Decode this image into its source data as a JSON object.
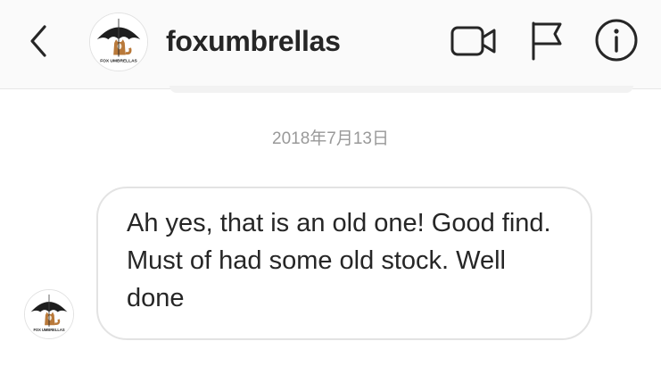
{
  "header": {
    "username": "foxumbrellas",
    "avatar_caption": "FOX UMBRELLAS"
  },
  "icons": {
    "back": "chevron-left-icon",
    "video": "video-camera-icon",
    "flag": "flag-icon",
    "info": "info-icon"
  },
  "conversation": {
    "date_separator": "2018年7月13日",
    "messages": [
      {
        "sender": "foxumbrellas",
        "text": "Ah yes, that is an old one! Good find. Must of had some old stock. Well done"
      }
    ]
  },
  "colors": {
    "header_bg": "#fafafa",
    "text": "#262626",
    "muted": "#999999",
    "bubble_border": "#e3e3e3"
  }
}
